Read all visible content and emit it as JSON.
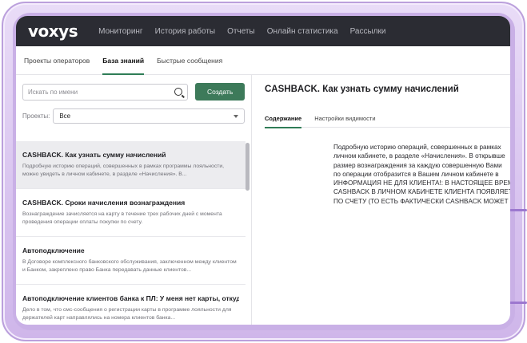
{
  "app": {
    "logo": "voxys"
  },
  "nav": [
    "Мониторинг",
    "История работы",
    "Отчеты",
    "Онлайн статистика",
    "Рассылки"
  ],
  "tabs": [
    "Проекты операторов",
    "База знаний",
    "Быстрые сообщения"
  ],
  "active_tab": "База знаний",
  "search": {
    "placeholder": "Искать по имени",
    "value": ""
  },
  "create_button": "Создать",
  "projects": {
    "label": "Проекты:",
    "selected": "Все"
  },
  "articles": [
    {
      "title": "CASHBACK. Как узнать сумму начислений",
      "desc": "Подробную историю операций, совершенных в рамках программы лояльности, можно увидеть в личном кабинете, в разделе «Начисления». В..."
    },
    {
      "title": "CASHBACK. Сроки начисления вознаграждения",
      "desc": "Вознаграждение зачисляется на карту в течение трех рабочих дней с момента проведения операции оплаты покупки по счету."
    },
    {
      "title": "Автоподключение",
      "desc": "В Договоре комплексного банковского обслуживания, заключенном между клиентом и Банком, закреплено право Банка передавать данные клиентов..."
    },
    {
      "title": "Автоподключение клиентов банка к ПЛ: У меня нет карты, откуда...",
      "desc": "Дело в том, что смс-сообщения о регистрации карты в программе лояльности для держателей карт направлялись на номера клиентов банка..."
    }
  ],
  "document": {
    "title": "CASHBACK. Как узнать сумму начислений",
    "tabs": [
      "Содержание",
      "Настройки видимости"
    ],
    "active_tab": "Содержание",
    "lines": [
      "Подробную историю операций, совершенных в рамках",
      "личном кабинете, в разделе «Начисления». В открывше",
      "размер вознаграждения за каждую совершенную Вами",
      "по операции отобразится в Вашем личном кабинете в",
      "ИНФОРМАЦИЯ НЕ ДЛЯ КЛИЕНТА!: В НАСТОЯЩЕЕ ВРЕМЯ",
      "CASHBACK В ЛИЧНОМ КАБИНЕТЕ КЛИЕНТА ПОЯВЛЯЕТ",
      "ПО СЧЕТУ (ТО ЕСТЬ ФАКТИЧЕСКИ CASHBACK МОЖЕТ Б"
    ]
  },
  "colors": {
    "topbar": "#2b2c33",
    "accent": "#3d7a5a",
    "frame": "#d8c3ef"
  }
}
